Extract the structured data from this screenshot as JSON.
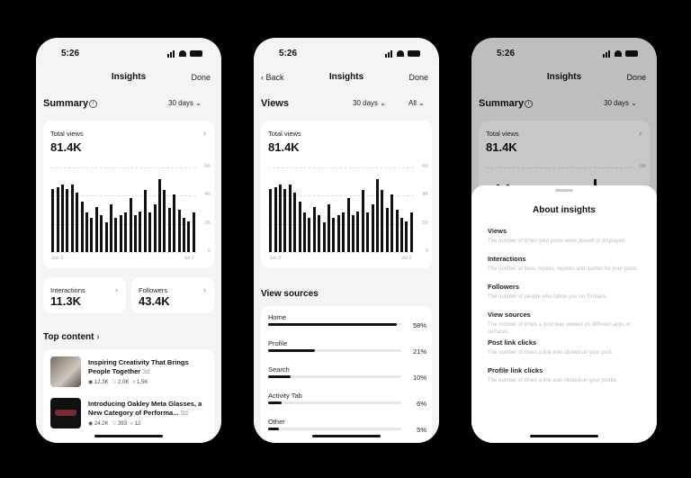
{
  "phone1": {
    "status_time": "5:26",
    "nav_title": "Insights",
    "nav_done": "Done",
    "section_title": "Summary",
    "range_chip": "30 days",
    "total_views_label": "Total views",
    "total_views_value": "81.4K",
    "interactions_label": "Interactions",
    "interactions_value": "11.3K",
    "followers_label": "Followers",
    "followers_value": "43.4K",
    "top_content_label": "Top content",
    "posts": [
      {
        "title": "Inspiring Creativity That Brings People Together",
        "age": "3d",
        "views": "12.3K",
        "likes": "2.0K",
        "replies": "1.5K"
      },
      {
        "title": "Introducing Oakley Meta Glasses, a New Category of Performa...",
        "age": "3d",
        "views": "24.2K",
        "likes": "393",
        "replies": "12"
      }
    ]
  },
  "phone2": {
    "status_time": "5:26",
    "nav_back": "Back",
    "nav_title": "Insights",
    "nav_done": "Done",
    "section_title": "Views",
    "range_chip": "30 days",
    "filter_chip": "All",
    "total_views_label": "Total views",
    "total_views_value": "81.4K",
    "view_sources_title": "View sources",
    "sources": [
      {
        "name": "Home",
        "pct_label": "58%",
        "pct": 58
      },
      {
        "name": "Profile",
        "pct_label": "21%",
        "pct": 21
      },
      {
        "name": "Search",
        "pct_label": "10%",
        "pct": 10
      },
      {
        "name": "Activity Tab",
        "pct_label": "6%",
        "pct": 6
      },
      {
        "name": "Other",
        "pct_label": "5%",
        "pct": 5
      }
    ]
  },
  "phone3": {
    "status_time": "5:26",
    "nav_title": "Insights",
    "nav_done": "Done",
    "section_title": "Summary",
    "range_chip": "30 days",
    "total_views_label": "Total views",
    "total_views_value": "81.4K",
    "sheet_title": "About insights",
    "terms": [
      {
        "name": "Views",
        "desc": "The number of times your posts were played or displayed."
      },
      {
        "name": "Interactions",
        "desc": "The number of likes, replies, reposts and quotes for your posts."
      },
      {
        "name": "Followers",
        "desc": "The number of people who follow you on Threads."
      },
      {
        "name": "View sources",
        "desc": "The number of times a post was viewed on different apps or surfaces."
      },
      {
        "name": "Post link clicks",
        "desc": "The number of times a link was clicked on your post."
      },
      {
        "name": "Profile link clicks",
        "desc": "The number of times a link was clicked on your profile."
      }
    ]
  },
  "chart_data": {
    "type": "bar",
    "title": "",
    "x_start_label": "Jun 3",
    "x_end_label": "Jul 2",
    "y_ticks": [
      "6K",
      "4K",
      "2K",
      "0"
    ],
    "ylim": [
      0,
      6
    ],
    "values": [
      4.5,
      4.6,
      4.8,
      4.5,
      4.8,
      4.2,
      3.6,
      2.8,
      2.4,
      3.2,
      2.6,
      2.1,
      3.4,
      2.4,
      2.6,
      2.8,
      3.8,
      2.6,
      2.9,
      4.4,
      2.8,
      3.4,
      5.2,
      4.4,
      3.1,
      4.1,
      3.0,
      2.4,
      2.2,
      2.8
    ]
  },
  "colors": {
    "background": "#000000",
    "screen": "#f4f4f4",
    "card": "#ffffff",
    "bar": "#111111",
    "track": "#e6e6e6"
  }
}
